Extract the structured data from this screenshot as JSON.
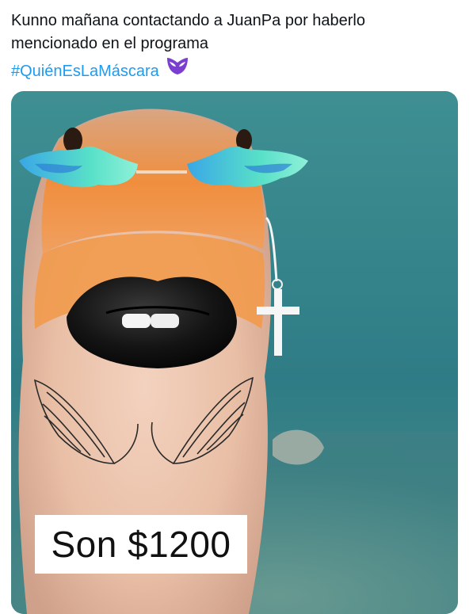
{
  "tweet": {
    "text_line1": "Kunno mañana contactando a JuanPa por haberlo",
    "text_line2": "mencionado en el programa",
    "hashtag": "#QuiénEsLaMáscara",
    "hashtag_emoji_icon": "purple-mask-icon"
  },
  "media": {
    "caption": "Son $1200"
  },
  "colors": {
    "hashtag": "#1d9bf0",
    "text": "#0f1419",
    "mask": "#7b3fd0"
  }
}
